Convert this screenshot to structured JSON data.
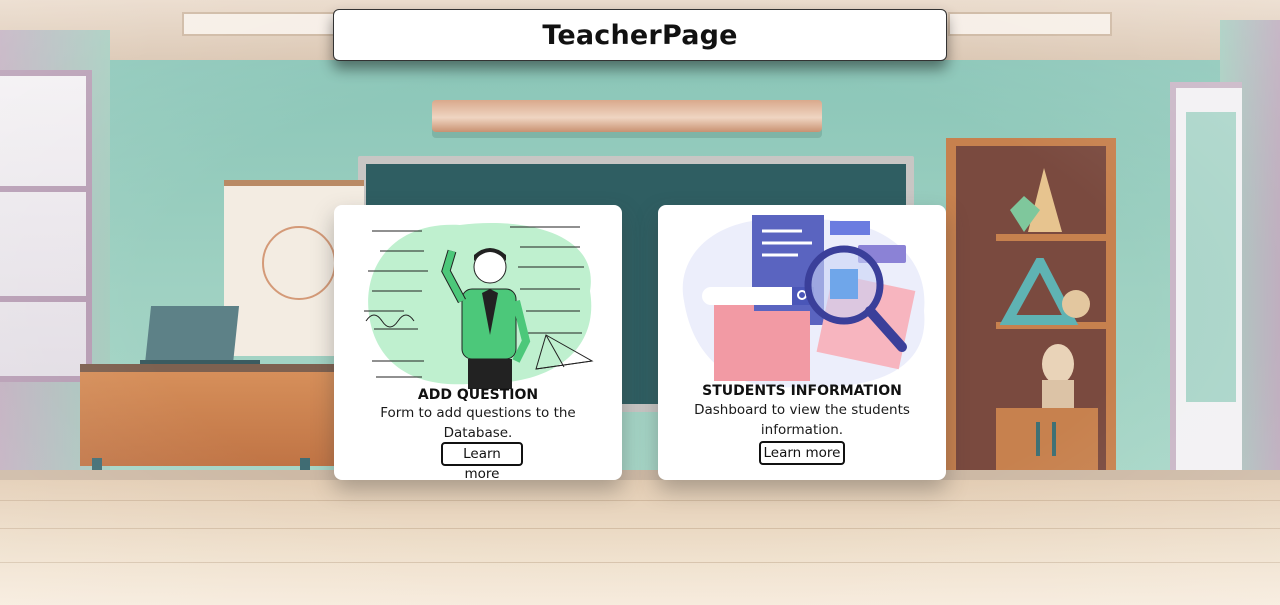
{
  "app": {
    "title": "TeacherPage"
  },
  "cards": [
    {
      "title": "ADD QUESTION",
      "description": "Form to add questions to the Database.",
      "button_label": "Learn more",
      "illustration": "teacher-at-chalkboard-illustration"
    },
    {
      "title": "STUDENTS INFORMATION",
      "description": "Dashboard to view the students information.",
      "button_label": "Learn more",
      "illustration": "folder-magnifier-search-illustration"
    }
  ],
  "colors": {
    "wall": "#9fd1c2",
    "board": "#2f5e62",
    "card_background": "#ffffff",
    "text": "#111111",
    "accent_green": "#4cc87a",
    "accent_blue": "#4a56b8",
    "accent_pink": "#f29aa4"
  }
}
